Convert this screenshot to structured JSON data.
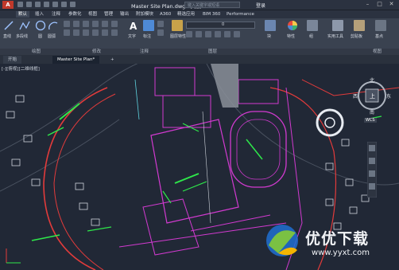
{
  "window": {
    "logo": "A",
    "title": "Master Site Plan.dwg - 只读",
    "search_placeholder": "键入关键字或短语",
    "login": "登录",
    "controls": [
      "–",
      "□",
      "✕"
    ]
  },
  "menu": {
    "items": [
      "默认",
      "插入",
      "注释",
      "参数化",
      "视图",
      "管理",
      "输出",
      "附加模块",
      "A360",
      "精选应用",
      "BIM 360",
      "Performance"
    ],
    "active_index": 0
  },
  "ribbon": {
    "draw": {
      "line": "直线",
      "polyline": "多段线",
      "circle": "圆",
      "arc": "圆弧"
    },
    "modify_text": "文字",
    "annotation": {
      "text": "文字",
      "dimension": "标注"
    },
    "layers": {
      "properties": "图层特性",
      "current_layer": "0"
    },
    "block": "块",
    "properties": "特性",
    "groups": "组",
    "utilities": "实用工具",
    "clipboard": "剪贴板",
    "base": "基点"
  },
  "panel_titles": {
    "draw": "绘图",
    "modify": "修改",
    "annotation": "注释",
    "layers": "图层",
    "view": "视图"
  },
  "doc_tabs": [
    "开始",
    "Master Site Plan*"
  ],
  "viewport": {
    "view_label": "[-][俯视][二维线框]"
  },
  "viewcube": {
    "north": "北",
    "south": "南",
    "west": "西",
    "east": "东",
    "top": "上",
    "wcs": "WCS"
  },
  "watermark": {
    "text": "优优下载",
    "url": "www.yyxt.com"
  },
  "colors": {
    "background": "#212836",
    "accent_red": "#c0392b",
    "magenta": "#d23ad0",
    "green": "#2ee84a"
  }
}
